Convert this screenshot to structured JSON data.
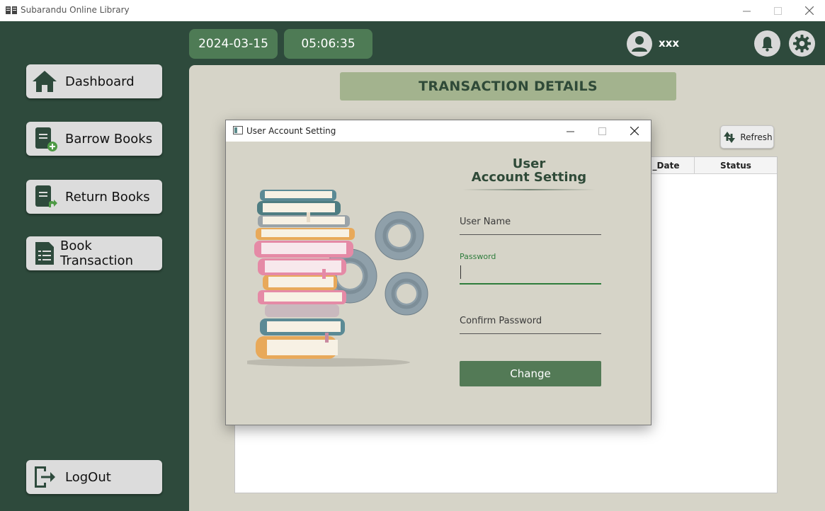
{
  "window": {
    "title": "Subarandu Online Library"
  },
  "topbar": {
    "date": "2024-03-15",
    "time": "05:06:35",
    "username": "xxx"
  },
  "sidebar": {
    "items": [
      {
        "label": "Dashboard"
      },
      {
        "label": "Barrow Books"
      },
      {
        "label": "Return Books"
      },
      {
        "label": "Book Transaction"
      }
    ],
    "logout_label": "LogOut"
  },
  "main": {
    "title": "TRANSACTION DETAILS",
    "refresh_label": "Refresh",
    "table": {
      "columns": [
        "_Date",
        "Status"
      ]
    }
  },
  "dialog": {
    "title": "User Account Setting",
    "heading_line1": "User",
    "heading_line2": "Account Setting",
    "username_label": "User Name",
    "password_label": "Password",
    "confirm_label": "Confirm Password",
    "change_label": "Change"
  },
  "colors": {
    "sidebar_bg": "#2e4a3c",
    "accent_green": "#4e7b55",
    "panel_bg": "#d6d4c8",
    "title_bar_bg": "#a3b38e",
    "focus_green": "#2e7d3c"
  }
}
